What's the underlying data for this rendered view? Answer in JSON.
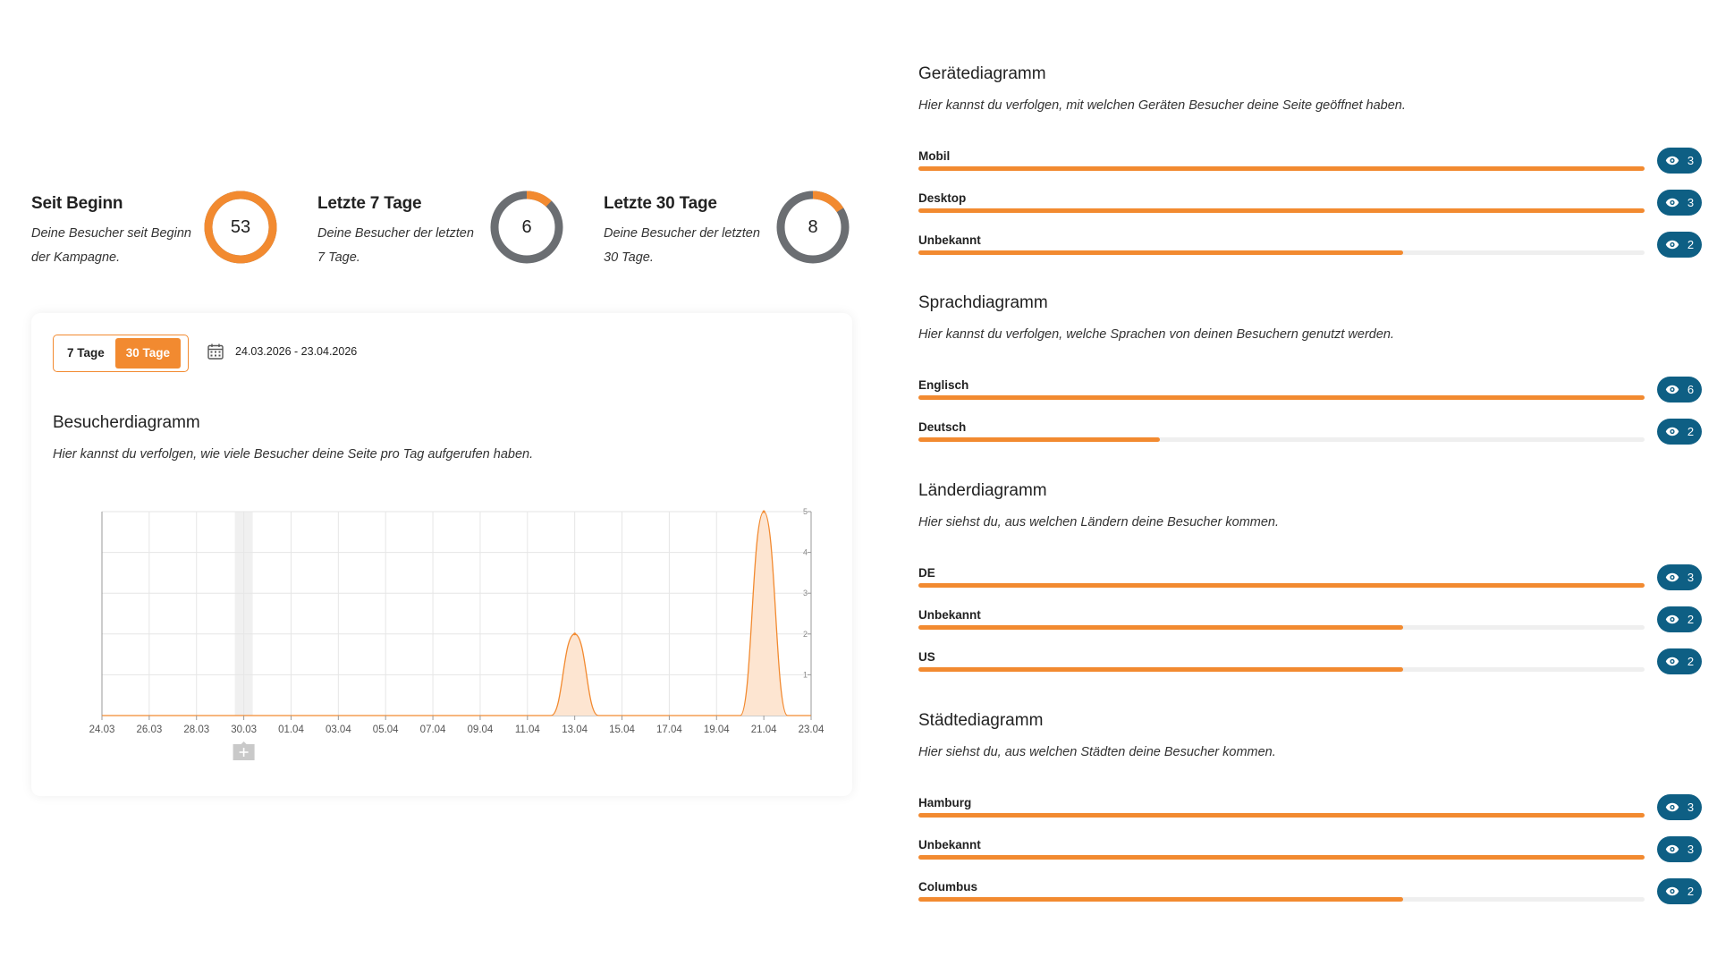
{
  "kpis": [
    {
      "title": "Seit Beginn",
      "desc": "Deine Besucher seit Beginn der Kampagne.",
      "value": "53",
      "fraction": 1.0,
      "color": "#f28a30"
    },
    {
      "title": "Letzte 7 Tage",
      "desc": "Deine Besucher der letzten 7 Tage.",
      "value": "6",
      "fraction": 0.12,
      "color": "#f28a30"
    },
    {
      "title": "Letzte 30 Tage",
      "desc": "Deine Besucher der letzten 30 Tage.",
      "value": "8",
      "fraction": 0.16,
      "color": "#f28a30"
    }
  ],
  "ring_track_color": "#6b6e72",
  "visitor_card": {
    "range_options": [
      "7 Tage",
      "30 Tage"
    ],
    "active_range": "30 Tage",
    "date_range": "24.03.2026 - 23.04.2026",
    "title": "Besucherdiagramm",
    "desc": "Hier kannst du verfolgen, wie viele Besucher deine Seite pro Tag aufgerufen haben."
  },
  "chart_data": {
    "type": "area",
    "x": [
      "24.03",
      "25.03",
      "26.03",
      "27.03",
      "28.03",
      "29.03",
      "30.03",
      "31.03",
      "01.04",
      "02.04",
      "03.04",
      "04.04",
      "05.04",
      "06.04",
      "07.04",
      "08.04",
      "09.04",
      "10.04",
      "11.04",
      "12.04",
      "13.04",
      "14.04",
      "15.04",
      "16.04",
      "17.04",
      "18.04",
      "19.04",
      "20.04",
      "21.04",
      "22.04",
      "23.04"
    ],
    "values": [
      0,
      0,
      0,
      0,
      0,
      0,
      0,
      0,
      0,
      0,
      0,
      0,
      0,
      0,
      0,
      0,
      0,
      0,
      0,
      0,
      2,
      0,
      0,
      0,
      0,
      0,
      0,
      0,
      5,
      0,
      0
    ],
    "x_ticks": [
      "24.03",
      "26.03",
      "28.03",
      "30.03",
      "01.04",
      "03.04",
      "05.04",
      "07.04",
      "09.04",
      "11.04",
      "13.04",
      "15.04",
      "17.04",
      "19.04",
      "21.04",
      "23.04"
    ],
    "y_ticks": [
      "1",
      "2",
      "3",
      "4",
      "5"
    ],
    "ylim": [
      0,
      5
    ],
    "grid": true,
    "color": "#f28a30",
    "fill": "#fde5d1",
    "highlight_x": "30.03"
  },
  "devices": {
    "title": "Gerätediagramm",
    "desc": "Hier kannst du verfolgen, mit welchen Geräten Besucher deine Seite geöffnet haben.",
    "items": [
      {
        "label": "Mobil",
        "count": "3",
        "fraction": 1.0
      },
      {
        "label": "Desktop",
        "count": "3",
        "fraction": 1.0
      },
      {
        "label": "Unbekannt",
        "count": "2",
        "fraction": 0.667
      }
    ]
  },
  "languages": {
    "title": "Sprachdiagramm",
    "desc": "Hier kannst du verfolgen, welche Sprachen von deinen Besuchern genutzt werden.",
    "items": [
      {
        "label": "Englisch",
        "count": "6",
        "fraction": 1.0
      },
      {
        "label": "Deutsch",
        "count": "2",
        "fraction": 0.333
      }
    ]
  },
  "countries": {
    "title": "Länderdiagramm",
    "desc": "Hier siehst du, aus welchen Ländern deine Besucher kommen.",
    "items": [
      {
        "label": "DE",
        "count": "3",
        "fraction": 1.0
      },
      {
        "label": "Unbekannt",
        "count": "2",
        "fraction": 0.667
      },
      {
        "label": "US",
        "count": "2",
        "fraction": 0.667
      }
    ]
  },
  "cities": {
    "title": "Städtediagramm",
    "desc": "Hier siehst du, aus welchen Städten deine Besucher kommen.",
    "items": [
      {
        "label": "Hamburg",
        "count": "3",
        "fraction": 1.0
      },
      {
        "label": "Unbekannt",
        "count": "3",
        "fraction": 1.0
      },
      {
        "label": "Columbus",
        "count": "2",
        "fraction": 0.667
      }
    ]
  },
  "icons": {
    "calendar": "calendar-icon",
    "eye": "eye-icon",
    "add": "add-annotation-icon"
  },
  "accent": "#f28a30",
  "pill_color": "#0e5f84"
}
